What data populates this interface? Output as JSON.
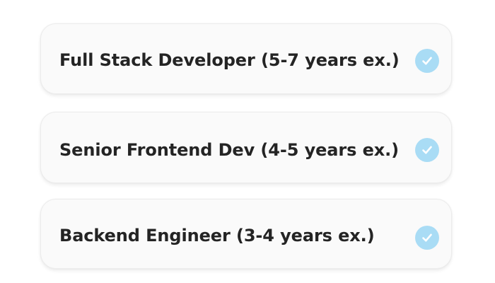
{
  "options": [
    {
      "label": "Full Stack Developer (5-7 years ex.)",
      "selected": true,
      "icon": "check-circle-icon"
    },
    {
      "label": "Senior Frontend Dev (4-5 years ex.)",
      "selected": true,
      "icon": "check-circle-icon"
    },
    {
      "label": "Backend Engineer (3-4 years ex.)",
      "selected": true,
      "icon": "check-circle-icon"
    }
  ],
  "colors": {
    "check_fill": "#a9dcf5",
    "check_mark": "#ffffff",
    "text": "#242424",
    "card_bg": "#fafafa"
  }
}
